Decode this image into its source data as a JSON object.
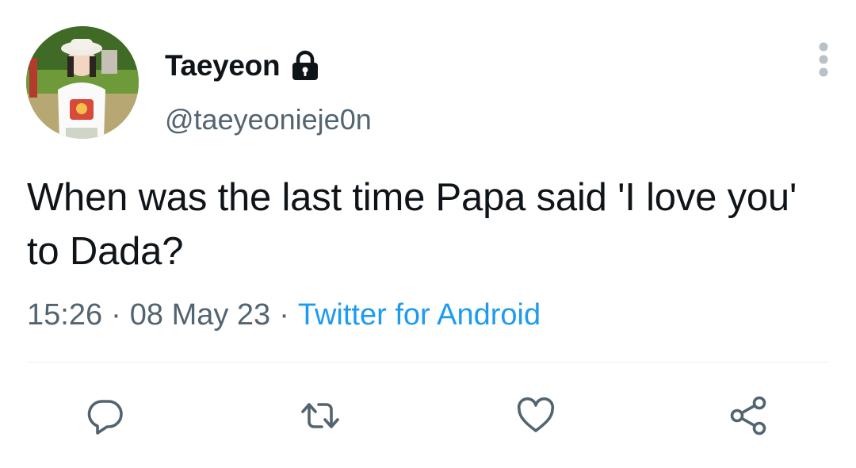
{
  "user": {
    "display_name": "Taeyeon",
    "handle": "@taeyeonieje0n",
    "protected_icon": "lock-icon",
    "avatar_icon": "profile-photo"
  },
  "tweet": {
    "text": "When was the last time Papa said 'I love you' to Dada?",
    "time": "15:26",
    "separator": "·",
    "date": "08 May 23",
    "source": "Twitter for Android"
  },
  "actions": [
    {
      "name": "reply",
      "icon": "reply-icon"
    },
    {
      "name": "retweet",
      "icon": "retweet-icon"
    },
    {
      "name": "like",
      "icon": "heart-icon"
    },
    {
      "name": "share",
      "icon": "share-icon"
    }
  ],
  "menu_icon": "more-vertical-icon",
  "colors": {
    "text": "#0f1419",
    "secondary": "#536471",
    "accent": "#1d9bf0",
    "divider": "#eff3f4"
  }
}
